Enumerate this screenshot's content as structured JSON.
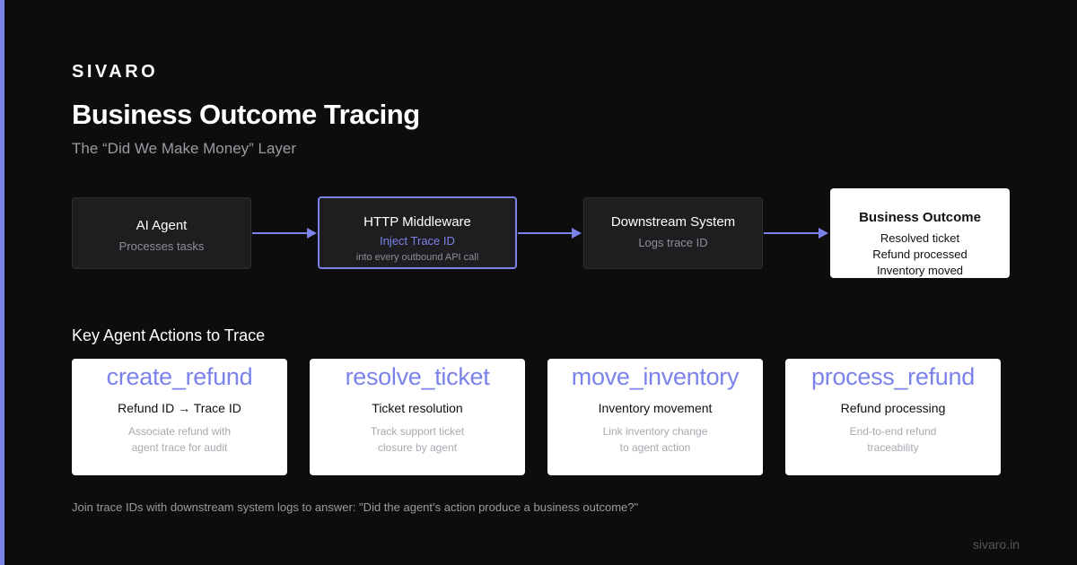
{
  "brand": "SIVARO",
  "title": "Business Outcome Tracing",
  "subtitle": "The “Did We Make Money” Layer",
  "flow": {
    "agent": {
      "title": "AI Agent",
      "sub": "Processes tasks"
    },
    "middleware": {
      "title": "HTTP Middleware",
      "accent": "Inject Trace ID",
      "sub": "into every outbound API call"
    },
    "downstream": {
      "title": "Downstream System",
      "sub": "Logs trace ID"
    },
    "outcome": {
      "title": "Business Outcome",
      "lines": [
        "Resolved ticket",
        "Refund processed",
        "Inventory moved"
      ]
    }
  },
  "section_title": "Key Agent Actions to Trace",
  "actions": [
    {
      "name": "create_refund",
      "label": "Refund ID → Trace ID",
      "desc": [
        "Associate refund with",
        "agent trace for audit"
      ]
    },
    {
      "name": "resolve_ticket",
      "label": "Ticket resolution",
      "desc": [
        "Track support ticket",
        "closure by agent"
      ]
    },
    {
      "name": "move_inventory",
      "label": "Inventory movement",
      "desc": [
        "Link inventory change",
        "to agent action"
      ]
    },
    {
      "name": "process_refund",
      "label": "Refund processing",
      "desc": [
        "End-to-end refund",
        "traceability"
      ]
    }
  ],
  "footnote": "Join trace IDs with downstream system logs to answer: \"Did the agent’s action produce a business outcome?\"",
  "url": "sivaro.in",
  "colors": {
    "accent": "#7b83eb",
    "background": "#0d0d0d",
    "box_dark": "#1e1e20",
    "box_light": "#ffffff"
  }
}
